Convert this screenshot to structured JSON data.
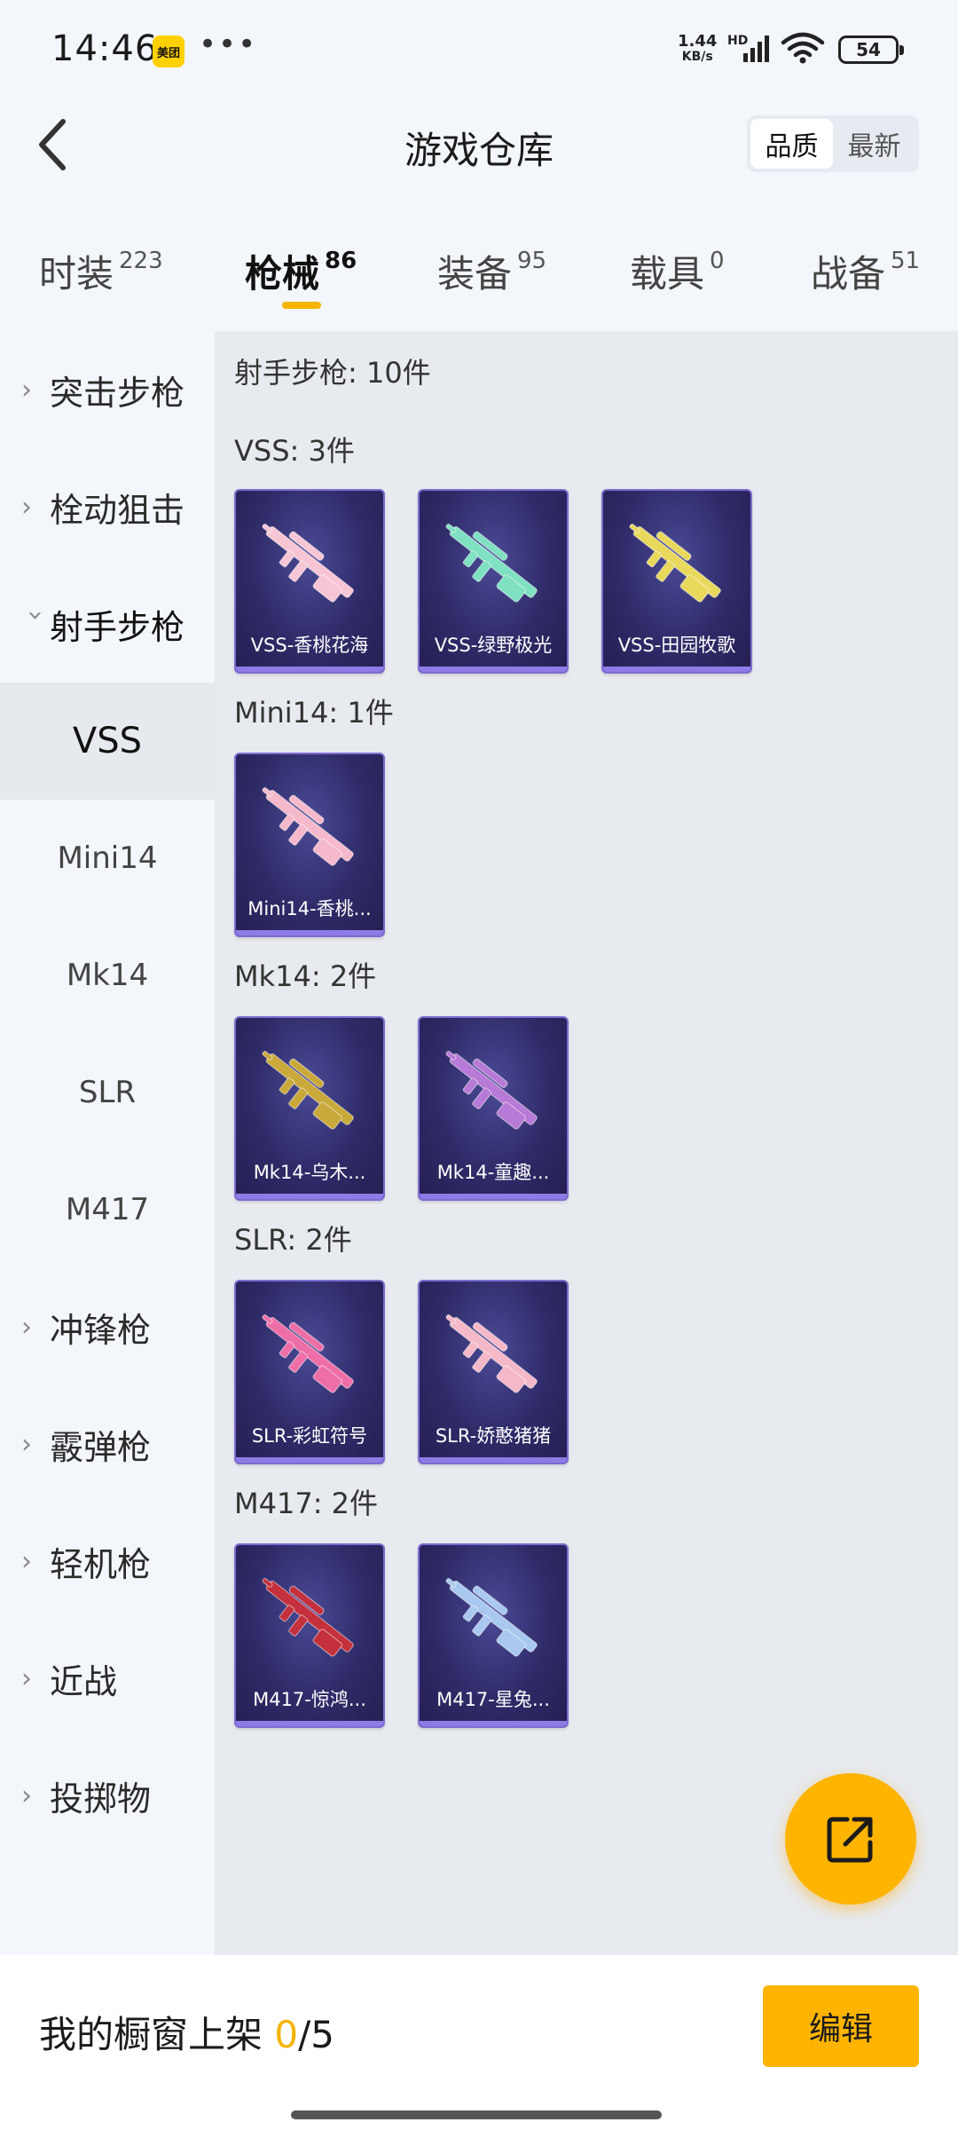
{
  "status_bar": {
    "time": "14:46",
    "app_badge": "美团",
    "more": "•••",
    "net_speed_value": "1.44",
    "net_speed_unit": "KB/s",
    "net_type": "HD",
    "battery": "54"
  },
  "header": {
    "title": "游戏仓库",
    "sort_options": [
      "品质",
      "最新"
    ],
    "sort_active": "品质"
  },
  "category_tabs": [
    {
      "label": "时装",
      "count": "223"
    },
    {
      "label": "枪械",
      "count": "86"
    },
    {
      "label": "装备",
      "count": "95"
    },
    {
      "label": "载具",
      "count": "0"
    },
    {
      "label": "战备",
      "count": "51"
    }
  ],
  "active_tab": "枪械",
  "sidebar": {
    "items": [
      {
        "label": "突击步枪",
        "type": "group",
        "expanded": false
      },
      {
        "label": "栓动狙击",
        "type": "group",
        "expanded": false
      },
      {
        "label": "射手步枪",
        "type": "group",
        "expanded": true
      },
      {
        "label": "VSS",
        "type": "sub",
        "selected": true
      },
      {
        "label": "Mini14",
        "type": "sub"
      },
      {
        "label": "Mk14",
        "type": "sub"
      },
      {
        "label": "SLR",
        "type": "sub"
      },
      {
        "label": "M417",
        "type": "sub"
      },
      {
        "label": "冲锋枪",
        "type": "group",
        "expanded": false
      },
      {
        "label": "霰弹枪",
        "type": "group",
        "expanded": false
      },
      {
        "label": "轻机枪",
        "type": "group",
        "expanded": false
      },
      {
        "label": "近战",
        "type": "group",
        "expanded": false
      },
      {
        "label": "投掷物",
        "type": "group",
        "expanded": false
      }
    ]
  },
  "content": {
    "category_header": "射手步枪: 10件",
    "sections": [
      {
        "label": "VSS: 3件",
        "items": [
          {
            "name": "VSS-香桃花海",
            "color": "#f7c6d4"
          },
          {
            "name": "VSS-绿野极光",
            "color": "#7fe0c2"
          },
          {
            "name": "VSS-田园牧歌",
            "color": "#e8d85c"
          }
        ]
      },
      {
        "label": "Mini14: 1件",
        "items": [
          {
            "name": "Mini14-香桃...",
            "color": "#f5b9cb"
          }
        ]
      },
      {
        "label": "Mk14: 2件",
        "items": [
          {
            "name": "Mk14-乌木...",
            "color": "#c9a93a"
          },
          {
            "name": "Mk14-童趣...",
            "color": "#b77ad6"
          }
        ]
      },
      {
        "label": "SLR: 2件",
        "items": [
          {
            "name": "SLR-彩虹符号",
            "color": "#ee6fa8"
          },
          {
            "name": "SLR-娇憨猪猪",
            "color": "#f4b8c8"
          }
        ]
      },
      {
        "label": "M417: 2件",
        "items": [
          {
            "name": "M417-惊鸿...",
            "color": "#c4303c"
          },
          {
            "name": "M417-星兔...",
            "color": "#a9c8ef"
          }
        ]
      }
    ]
  },
  "fab": {
    "icon": "share-icon"
  },
  "bottom_bar": {
    "showcase_label": "我的橱窗上架",
    "showcase_current": "0",
    "showcase_total": "/5",
    "edit_label": "编辑"
  },
  "colors": {
    "accent": "#f5b400",
    "card_bg": "#2f2b68",
    "card_border": "#7b6dd0"
  }
}
